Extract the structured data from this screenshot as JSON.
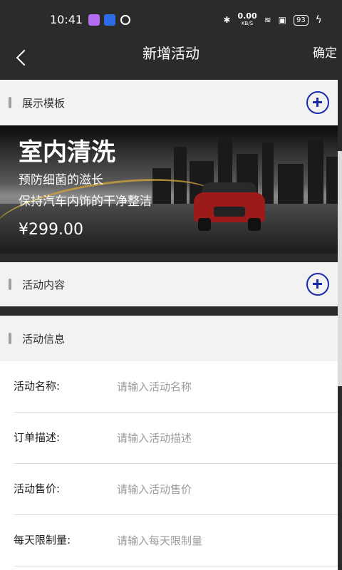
{
  "status_bar": {
    "time": "10:41",
    "net_speed": "0.00",
    "net_unit": "KB/S",
    "battery": "93"
  },
  "header": {
    "title": "新增活动",
    "confirm_label": "确定"
  },
  "sections": {
    "template": {
      "label": "展示模板"
    },
    "content": {
      "label": "活动内容"
    },
    "info": {
      "label": "活动信息"
    }
  },
  "banner": {
    "title": "室内清洗",
    "line1": "预防细菌的滋长",
    "line2": "保持汽车内饰的干净整洁",
    "price": "¥299.00"
  },
  "form": {
    "fields": [
      {
        "label": "活动名称:",
        "placeholder": "请输入活动名称",
        "value": ""
      },
      {
        "label": "订单描述:",
        "placeholder": "请输入活动描述",
        "value": ""
      },
      {
        "label": "活动售价:",
        "placeholder": "请输入活动售价",
        "value": ""
      },
      {
        "label": "每天限制量:",
        "placeholder": "请输入每天限制量",
        "value": ""
      }
    ]
  }
}
